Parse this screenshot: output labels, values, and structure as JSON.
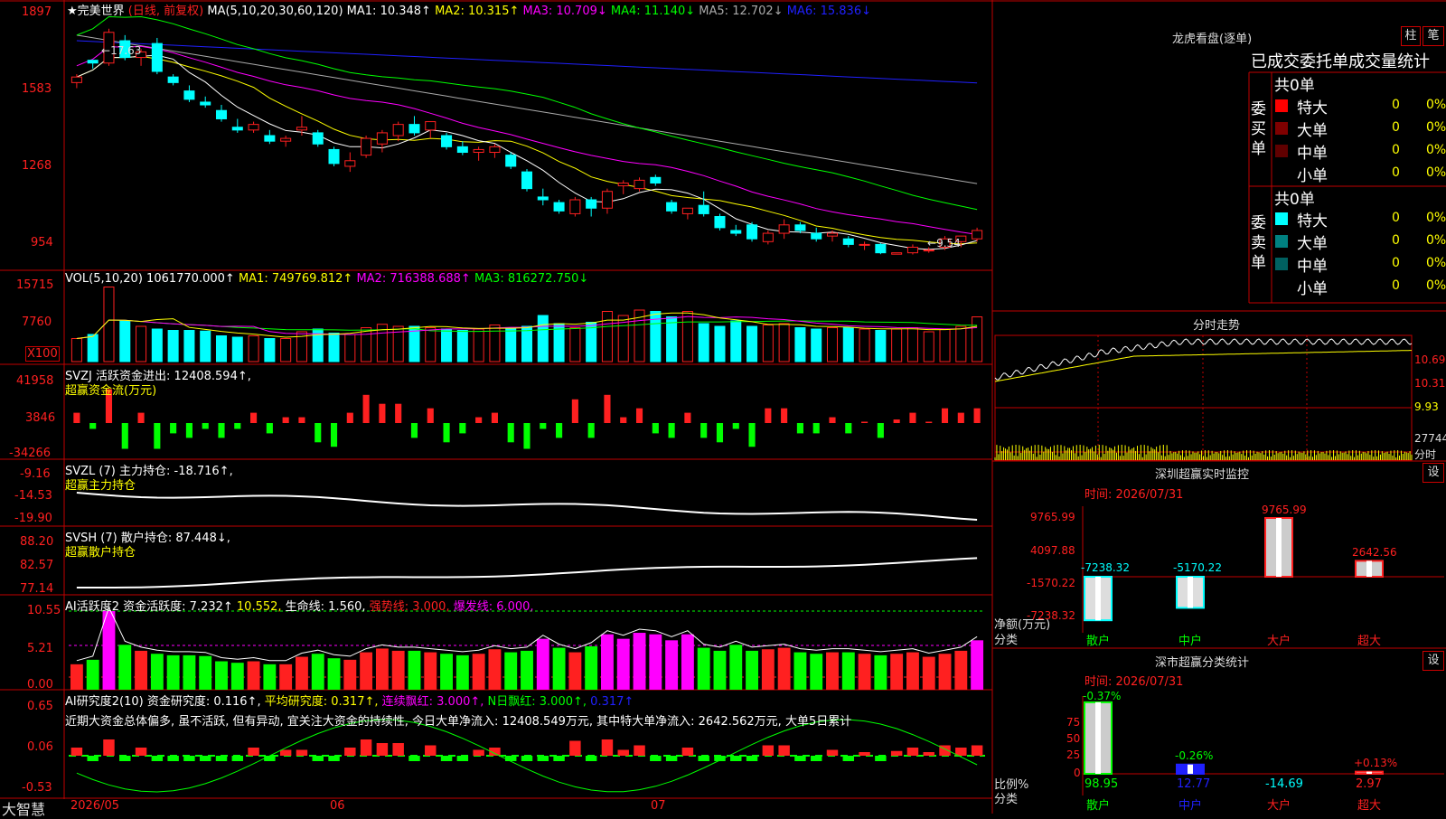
{
  "colors": {
    "up": "#ff2020",
    "down": "#00ffff",
    "grid": "#c00000",
    "yellow": "#ffff00",
    "green": "#00ff00",
    "magenta": "#ff00ff",
    "white": "#ffffff",
    "blue": "#2020ff",
    "gray": "#aaaaaa"
  },
  "main": {
    "title": "★完美世界",
    "period": "(日线, 前复权)",
    "ma_header": "MA(5,10,20,30,60,120)",
    "mas": [
      {
        "label": "MA1: 10.348↑",
        "color": "#ffffff"
      },
      {
        "label": "MA2: 10.315↑",
        "color": "#ffff00"
      },
      {
        "label": "MA3: 10.709↓",
        "color": "#ff00ff"
      },
      {
        "label": "MA4: 11.140↓",
        "color": "#00ff00"
      },
      {
        "label": "MA5: 12.702↓",
        "color": "#aaaaaa"
      },
      {
        "label": "MA6: 15.836↓",
        "color": "#2020ff"
      }
    ],
    "y_labels": [
      "1897",
      "1583",
      "1268",
      "954"
    ],
    "high_mark": "17.63",
    "low_mark": "9.54"
  },
  "volume": {
    "header_name": "VOL(5,10,20)",
    "value": "1061770.000↑",
    "ma1": "MA1: 749769.812↑",
    "ma2": "MA2: 716388.688↑",
    "ma3": "MA3: 816272.750↓",
    "y_labels": [
      "15715",
      "7760",
      "X100"
    ]
  },
  "svzj": {
    "name": "SVZJ",
    "text": "活跃资金进出: 12408.594↑,",
    "sub": "超赢资金流(万元)",
    "y_labels": [
      "41958",
      "3846",
      "-34266"
    ]
  },
  "svzl": {
    "name": "SVZL (7)",
    "text": "主力持仓: -18.716↑,",
    "sub": "超赢主力持仓",
    "y_labels": [
      "-9.16",
      "-14.53",
      "-19.90"
    ]
  },
  "svsh": {
    "name": "SVSH (7)",
    "text": "散户持仓: 87.448↓,",
    "sub": "超赢散户持仓",
    "y_labels": [
      "88.20",
      "82.57",
      "77.14"
    ]
  },
  "ai_active": {
    "name": "AI活跃度2",
    "text1": "资金活跃度: 7.232↑",
    "text2": "10.552,",
    "text3": "生命线: 1.560,",
    "text4": "强势线: 3.000,",
    "text5": "爆发线: 6.000,",
    "y_labels": [
      "10.55",
      "5.21",
      "0.00"
    ]
  },
  "ai_research": {
    "name": "AI研究度2(10)",
    "t1": "资金研究度: 0.116↑,",
    "t2": "平均研究度: 0.317↑,",
    "t3": "连续飘红: 3.000↑,",
    "t4": "N日飘红: 3.000↑,",
    "t5": "0.317↑",
    "note": "近期大资金总体偏多, 虽不活跃, 但有异动, 宜关注大资金的持续性, 今日大单净流入: 12408.549万元, 其中特大单净流入: 2642.562万元, 大单5日累计",
    "y_labels": [
      "0.65",
      "0.06",
      "-0.53"
    ]
  },
  "bottom": {
    "brand": "大智慧",
    "dates": [
      "2026/05",
      "06",
      "07"
    ]
  },
  "lhb": {
    "title": "龙虎看盘(逐单)",
    "btn_zhu": "柱",
    "btn_bi": "笔",
    "header": "已成交委托单成交量统计",
    "buy_label": "委买单",
    "sell_label": "委卖单",
    "buy_total": "共0单",
    "sell_total": "共0单",
    "buy_rows": [
      {
        "name": "特大",
        "count": "0",
        "pct": "0%",
        "swatch": "#ff0000"
      },
      {
        "name": "大单",
        "count": "0",
        "pct": "0%",
        "swatch": "#800000"
      },
      {
        "name": "中单",
        "count": "0",
        "pct": "0%",
        "swatch": "#600000"
      },
      {
        "name": "小单",
        "count": "0",
        "pct": "0%",
        "swatch": ""
      }
    ],
    "sell_rows": [
      {
        "name": "特大",
        "count": "0",
        "pct": "0%",
        "swatch": "#00ffff"
      },
      {
        "name": "大单",
        "count": "0",
        "pct": "0%",
        "swatch": "#008080"
      },
      {
        "name": "中单",
        "count": "0",
        "pct": "0%",
        "swatch": "#006060"
      },
      {
        "name": "小单",
        "count": "0",
        "pct": "0%",
        "swatch": ""
      }
    ]
  },
  "intraday": {
    "title": "分时走势",
    "y_labels": [
      "10.69",
      "10.31",
      "9.93",
      "27744"
    ],
    "vol_label": "分时"
  },
  "sz_monitor": {
    "title": "深圳超赢实时监控",
    "btn": "设",
    "time": "时间: 2026/07/31",
    "y_labels": [
      "9765.99",
      "4097.88",
      "-1570.22",
      "-7238.32"
    ],
    "axis_unit": "净额(万元)",
    "axis_name": "分类",
    "categories": [
      "散户",
      "中户",
      "大户",
      "超大"
    ],
    "values": [
      -7238.32,
      -5170.22,
      9765.99,
      2642.56
    ],
    "value_labels": [
      "-7238.32",
      "-5170.22",
      "9765.99",
      "2642.56"
    ]
  },
  "sz_class": {
    "title": "深市超赢分类统计",
    "btn": "设",
    "time": "时间: 2026/07/31",
    "y_labels": [
      "75",
      "50",
      "25",
      "0"
    ],
    "axis_unit": "比例%",
    "axis_name": "分类",
    "categories": [
      "散户",
      "中户",
      "大户",
      "超大"
    ],
    "pct_changes": [
      "-0.37%",
      "-0.26%",
      "",
      "+0.13%"
    ],
    "values": [
      98.95,
      12.77,
      -14.69,
      2.97
    ],
    "value_labels": [
      "98.95",
      "12.77",
      "-14.69",
      "2.97"
    ]
  },
  "chart_data": {
    "type": "candlestick",
    "dates": [
      "2026/05",
      "06",
      "07"
    ],
    "candles": [
      [
        15.7,
        16.0,
        15.5,
        15.9
      ],
      [
        16.5,
        16.5,
        16.2,
        16.4
      ],
      [
        16.4,
        17.63,
        16.3,
        17.5
      ],
      [
        17.2,
        17.4,
        16.5,
        16.6
      ],
      [
        16.6,
        16.9,
        16.3,
        16.8
      ],
      [
        17.1,
        17.3,
        16.0,
        16.1
      ],
      [
        15.9,
        16.0,
        15.6,
        15.7
      ],
      [
        15.4,
        15.6,
        15.0,
        15.1
      ],
      [
        15.0,
        15.2,
        14.8,
        14.9
      ],
      [
        14.7,
        14.9,
        14.3,
        14.4
      ],
      [
        14.1,
        14.4,
        13.9,
        14.0
      ],
      [
        14.0,
        14.3,
        13.9,
        14.2
      ],
      [
        13.8,
        14.0,
        13.5,
        13.6
      ],
      [
        13.6,
        13.8,
        13.4,
        13.7
      ],
      [
        14.0,
        14.5,
        13.8,
        14.1
      ],
      [
        13.9,
        14.0,
        13.4,
        13.5
      ],
      [
        13.3,
        13.4,
        12.7,
        12.8
      ],
      [
        12.7,
        13.2,
        12.5,
        12.9
      ],
      [
        13.1,
        13.8,
        13.0,
        13.7
      ],
      [
        13.5,
        14.0,
        13.2,
        13.9
      ],
      [
        13.8,
        14.3,
        13.6,
        14.2
      ],
      [
        14.2,
        14.5,
        13.8,
        13.9
      ],
      [
        14.0,
        14.3,
        13.7,
        14.3
      ],
      [
        13.8,
        13.9,
        13.3,
        13.4
      ],
      [
        13.4,
        13.6,
        13.1,
        13.2
      ],
      [
        13.2,
        13.4,
        12.9,
        13.3
      ],
      [
        13.2,
        13.5,
        13.0,
        13.4
      ],
      [
        13.1,
        13.2,
        12.6,
        12.7
      ],
      [
        12.5,
        12.6,
        11.8,
        11.9
      ],
      [
        11.6,
        11.9,
        11.3,
        11.5
      ],
      [
        11.4,
        11.5,
        11.0,
        11.1
      ],
      [
        11.0,
        11.6,
        10.9,
        11.5
      ],
      [
        11.5,
        11.6,
        10.9,
        11.2
      ],
      [
        11.2,
        11.9,
        11.0,
        11.8
      ],
      [
        12.0,
        12.2,
        11.7,
        12.1
      ],
      [
        11.9,
        12.3,
        11.8,
        12.2
      ],
      [
        12.3,
        12.4,
        12.0,
        12.1
      ],
      [
        11.4,
        11.5,
        11.0,
        11.1
      ],
      [
        11.0,
        11.2,
        10.8,
        11.2
      ],
      [
        11.3,
        11.8,
        10.9,
        11.0
      ],
      [
        10.9,
        11.0,
        10.4,
        10.5
      ],
      [
        10.4,
        10.6,
        10.2,
        10.3
      ],
      [
        10.6,
        10.7,
        10.0,
        10.1
      ],
      [
        10.0,
        10.4,
        9.9,
        10.3
      ],
      [
        10.3,
        10.8,
        10.1,
        10.6
      ],
      [
        10.6,
        10.7,
        10.3,
        10.4
      ],
      [
        10.3,
        10.5,
        10.0,
        10.1
      ],
      [
        10.2,
        10.4,
        10.0,
        10.3
      ],
      [
        10.1,
        10.2,
        9.8,
        9.9
      ],
      [
        9.9,
        10.0,
        9.7,
        9.9
      ],
      [
        9.9,
        9.95,
        9.55,
        9.6
      ],
      [
        9.55,
        9.6,
        9.54,
        9.6
      ],
      [
        9.6,
        9.9,
        9.54,
        9.8
      ],
      [
        9.7,
        9.8,
        9.6,
        9.7
      ],
      [
        9.8,
        10.2,
        9.7,
        10.1
      ],
      [
        10.0,
        10.2,
        9.8,
        10.2
      ],
      [
        10.1,
        10.5,
        10.0,
        10.4
      ]
    ],
    "volumes": [
      34,
      40,
      110,
      60,
      52,
      48,
      46,
      46,
      45,
      38,
      36,
      38,
      34,
      34,
      44,
      48,
      42,
      40,
      50,
      55,
      52,
      52,
      50,
      48,
      46,
      48,
      54,
      50,
      52,
      68,
      56,
      50,
      58,
      74,
      68,
      76,
      74,
      66,
      74,
      56,
      52,
      60,
      52,
      54,
      56,
      50,
      48,
      50,
      50,
      48,
      46,
      48,
      50,
      44,
      48,
      52,
      66
    ],
    "ylim": [
      9.54,
      17.63
    ]
  }
}
